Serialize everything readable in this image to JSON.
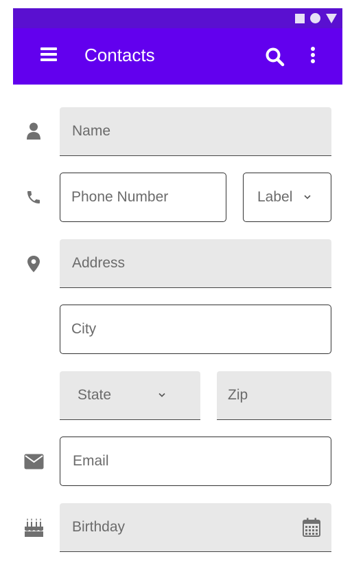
{
  "app": {
    "title": "Contacts"
  },
  "appbar": {
    "menu_icon": "menu-icon",
    "search_icon": "search-icon",
    "more_icon": "more-vert-icon"
  },
  "form": {
    "name": {
      "placeholder": "Name",
      "icon": "person-icon"
    },
    "phone": {
      "placeholder": "Phone Number",
      "icon": "phone-icon"
    },
    "phone_label": {
      "value": "Label",
      "icon": "chevron-down-icon"
    },
    "address": {
      "placeholder": "Address",
      "icon": "location-pin-icon"
    },
    "city": {
      "placeholder": "City"
    },
    "state": {
      "value": "State",
      "icon": "chevron-down-icon"
    },
    "zip": {
      "placeholder": "Zip"
    },
    "email": {
      "placeholder": "Email",
      "icon": "envelope-icon"
    },
    "birthday": {
      "placeholder": "Birthday",
      "icon": "cake-icon",
      "trailing_icon": "calendar-icon"
    }
  },
  "colors": {
    "statusbar": "#5a10d0",
    "appbar": "#6200ee",
    "filled_bg": "#e8e8e8",
    "icon_gray": "#707070"
  }
}
